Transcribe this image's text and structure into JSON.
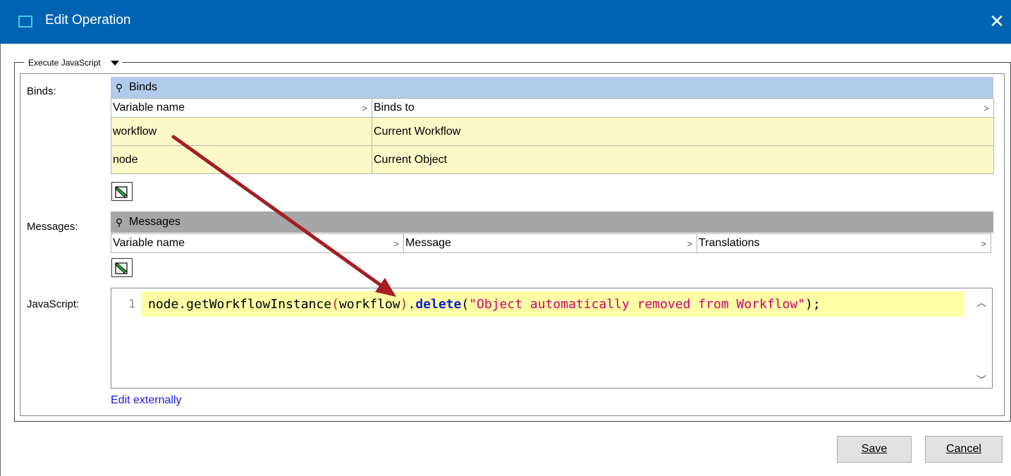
{
  "window": {
    "title": "Edit Operation",
    "close_glyph": "✕",
    "title_bar_color": "#0063b1"
  },
  "operation": {
    "type_label": "Execute JavaScript"
  },
  "binds": {
    "label": "Binds:",
    "section_title": "Binds",
    "columns": [
      "Variable name",
      "Binds to"
    ],
    "rows": [
      {
        "variable": "workflow",
        "binds_to": "Current Workflow"
      },
      {
        "variable": "node",
        "binds_to": "Current Object"
      }
    ],
    "edit_icon": "edit-pencil-icon"
  },
  "messages": {
    "label": "Messages:",
    "section_title": "Messages",
    "columns": [
      "Variable name",
      "Message",
      "Translations"
    ],
    "edit_icon": "edit-pencil-icon"
  },
  "javascript": {
    "label": "JavaScript:",
    "line_number": "1",
    "code": {
      "t1": "node.getWorkflowInstance",
      "t2": "(",
      "t3": "workflow",
      "t4": ")",
      "t5": ".",
      "t6": "delete",
      "t7": "(",
      "t8": "\"Object automatically removed from Workflow\"",
      "t9": ");"
    },
    "edit_externally_link": "Edit externally"
  },
  "buttons": {
    "save": "Save",
    "cancel": "Cancel"
  },
  "colors": {
    "binds_header": "#b3cbea",
    "messages_header": "#a6a6a6",
    "row_highlight": "#fcf8c8",
    "code_line_highlight": "#ffffa6",
    "annotation_arrow": "#a31f24"
  }
}
